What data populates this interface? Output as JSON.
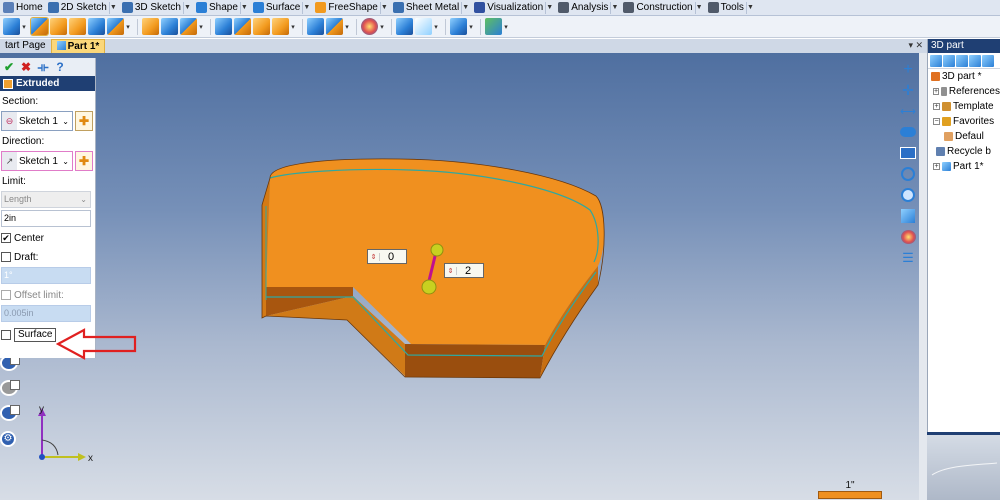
{
  "ribbon": {
    "tabs": [
      {
        "label": "Home",
        "icon": "home-icon",
        "color": "#5a7fb8"
      },
      {
        "label": "2D Sketch",
        "icon": "sketch-pencil-icon",
        "color": "#3a6fb0"
      },
      {
        "label": "3D Sketch",
        "icon": "sketch-3d-icon",
        "color": "#3a6fb0"
      },
      {
        "label": "Shape",
        "icon": "shape-cube-icon",
        "color": "#2b7fd6"
      },
      {
        "label": "Surface",
        "icon": "surface-icon",
        "color": "#2b7fd6"
      },
      {
        "label": "FreeShape",
        "icon": "freeshape-icon",
        "color": "#f29a1e"
      },
      {
        "label": "Sheet Metal",
        "icon": "sheet-metal-icon",
        "color": "#3a6fb0"
      },
      {
        "label": "Visualization",
        "icon": "visualization-icon",
        "color": "#3050a0"
      },
      {
        "label": "Analysis",
        "icon": "analysis-icon",
        "color": "#505a6a"
      },
      {
        "label": "Construction",
        "icon": "construction-icon",
        "color": "#505a6a"
      },
      {
        "label": "Tools",
        "icon": "tools-icon",
        "color": "#505a6a"
      }
    ]
  },
  "doc_tabs": {
    "items": [
      {
        "label": "tart Page",
        "active": false
      },
      {
        "label": "Part 1*",
        "active": true
      }
    ],
    "controls": "▾ ✕"
  },
  "panel": {
    "title": "Extruded",
    "section_label": "Section:",
    "section_value": "Sketch 1",
    "direction_label": "Direction:",
    "direction_value": "Sketch 1",
    "limit_label": "Limit:",
    "limit_type": "Length",
    "limit_value": "2in",
    "center_label": "Center",
    "center_checked": true,
    "draft_label": "Draft:",
    "draft_checked": false,
    "draft_value": "1°",
    "offset_label": "Offset limit:",
    "offset_value": "0.005in",
    "surface_label": "Surface",
    "surface_checked": false
  },
  "viewport": {
    "dim_a": "0",
    "dim_b": "2",
    "axis_y": "y",
    "axis_x": "x",
    "ruler_label": "1\"",
    "part_color": "#f0901f",
    "part_edge_color": "#2fa8a0"
  },
  "tree": {
    "title": "3D part",
    "nodes": [
      {
        "label": "3D part *",
        "expander": "",
        "icon": "part-icon"
      },
      {
        "label": "References",
        "expander": "+",
        "icon": "references-icon"
      },
      {
        "label": "Template",
        "expander": "+",
        "icon": "template-icon"
      },
      {
        "label": "Favorites",
        "expander": "−",
        "icon": "favorites-icon"
      },
      {
        "label": "Defaul",
        "expander": "",
        "icon": "default-icon"
      },
      {
        "label": "Recycle b",
        "expander": "",
        "icon": "recycle-bin-icon"
      },
      {
        "label": "Part 1*",
        "expander": "+",
        "icon": "part-icon"
      }
    ]
  }
}
